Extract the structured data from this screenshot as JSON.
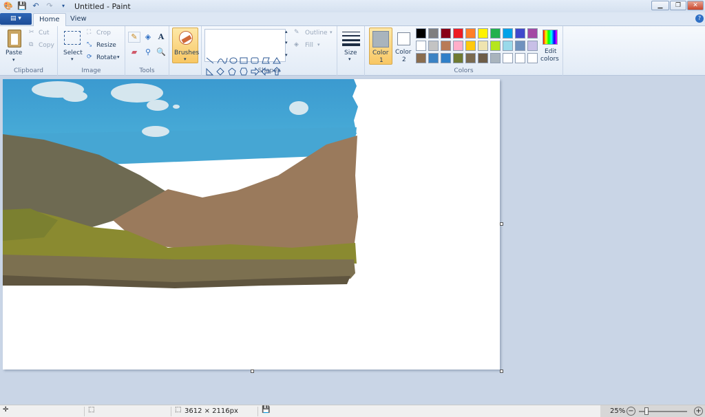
{
  "window": {
    "title": "Untitled - Paint"
  },
  "tabs": [
    {
      "label": "Home"
    },
    {
      "label": "View"
    }
  ],
  "clipboard": {
    "paste": "Paste",
    "cut": "Cut",
    "copy": "Copy",
    "label": "Clipboard"
  },
  "image": {
    "select": "Select",
    "crop": "Crop",
    "resize": "Resize",
    "rotate": "Rotate",
    "label": "Image"
  },
  "tools": {
    "label": "Tools"
  },
  "brushes": {
    "label": "Brushes"
  },
  "shapes": {
    "label": "Shapes",
    "outline": "Outline",
    "fill": "Fill"
  },
  "size": {
    "label": "Size"
  },
  "colors": {
    "color1_label": "Color",
    "color1_num": "1",
    "color2_label": "Color",
    "color2_num": "2",
    "edit_label": "Edit",
    "edit_label2": "colors",
    "label": "Colors",
    "color1": "#a9b4bd",
    "color2": "#ffffff",
    "palette": [
      "#000000",
      "#7f7f7f",
      "#880015",
      "#ed1c24",
      "#ff7f27",
      "#fff200",
      "#22b14c",
      "#00a2e8",
      "#3f48cc",
      "#a349a4",
      "#ffffff",
      "#c3c3c3",
      "#b97a57",
      "#ffaec9",
      "#ffc90e",
      "#efe4b0",
      "#b5e61d",
      "#99d9ea",
      "#7092be",
      "#c8bfe7",
      "#8a6d4f",
      "#3a82c4",
      "#2f7fc8",
      "#6f7a32",
      "#7a6a50",
      "#6e5d48",
      "#a9b4bd",
      "#ffffff",
      "#ffffff",
      "#ffffff"
    ]
  },
  "status": {
    "dimensions": "3612 × 2116px",
    "zoom": "25%"
  }
}
